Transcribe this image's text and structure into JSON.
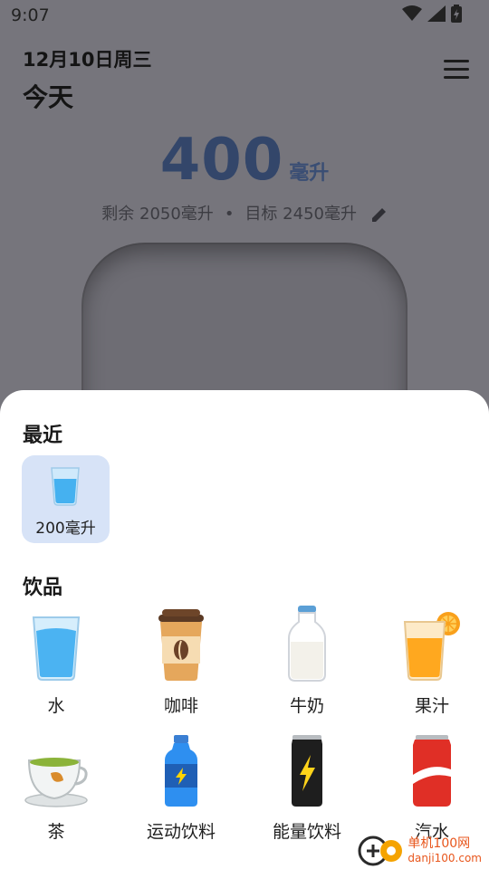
{
  "status": {
    "time": "9:07",
    "icons": [
      "wifi-icon",
      "signal-icon",
      "battery-icon"
    ]
  },
  "header": {
    "date": "12月10日周三",
    "title": "今天",
    "menu_icon": "hamburger-menu-icon"
  },
  "intake": {
    "amount": "400",
    "unit": "毫升",
    "remaining": "剩余 2050毫升",
    "separator": "•",
    "goal": "目标 2450毫升",
    "edit_icon": "pencil-icon"
  },
  "recent": {
    "title": "最近",
    "items": [
      {
        "label": "200毫升",
        "icon": "water-glass-icon"
      }
    ]
  },
  "drinks": {
    "title": "饮品",
    "items": [
      {
        "label": "水",
        "icon": "water-glass-icon"
      },
      {
        "label": "咖啡",
        "icon": "coffee-cup-icon"
      },
      {
        "label": "牛奶",
        "icon": "milk-bottle-icon"
      },
      {
        "label": "果汁",
        "icon": "juice-glass-icon"
      },
      {
        "label": "茶",
        "icon": "tea-cup-icon"
      },
      {
        "label": "运动饮料",
        "icon": "sports-drink-icon"
      },
      {
        "label": "能量饮料",
        "icon": "energy-drink-icon"
      },
      {
        "label": "汽水",
        "icon": "soda-can-icon"
      }
    ]
  },
  "watermark": {
    "line1": "单机100网",
    "line2": "danji100.com"
  },
  "colors": {
    "accent": "#33466a",
    "sheet": "#ffffff",
    "recent_card": "#d7e3f7",
    "scrim": "#76757c"
  }
}
